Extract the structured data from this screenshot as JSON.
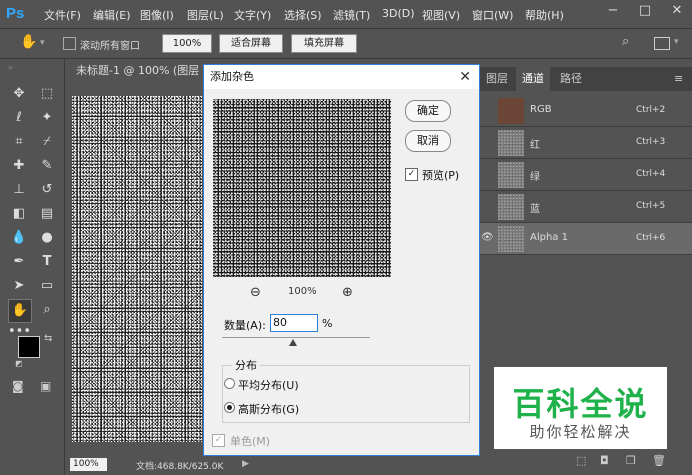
{
  "app": {
    "logo": "Ps"
  },
  "menu": [
    "文件(F)",
    "编辑(E)",
    "图像(I)",
    "图层(L)",
    "文字(Y)",
    "选择(S)",
    "滤镜(T)",
    "3D(D)",
    "视图(V)",
    "窗口(W)",
    "帮助(H)"
  ],
  "options": {
    "scroll_all_label": "滚动所有窗口",
    "zoom_value": "100%",
    "fit_screen": "适合屏幕",
    "fill_screen": "填充屏幕"
  },
  "document": {
    "tab_title": "未标题-1 @ 100% (图层 1",
    "status_zoom": "100%",
    "status_doc": "文档:468.8K/625.0K"
  },
  "dialog": {
    "title": "添加杂色",
    "ok": "确定",
    "cancel": "取消",
    "preview_label": "预览(P)",
    "preview_zoom": "100%",
    "amount_label": "数量(A):",
    "amount_value": "80",
    "amount_unit": "%",
    "amount_slider_fraction": 0.48,
    "distribution_label": "分布",
    "dist_uniform": "平均分布(U)",
    "dist_gaussian": "高斯分布(G)",
    "monochrome": "单色(M)"
  },
  "panel": {
    "tabs": [
      "图层",
      "通道",
      "路径"
    ],
    "channels": [
      {
        "name": "RGB",
        "shortcut": "Ctrl+2"
      },
      {
        "name": "红",
        "shortcut": "Ctrl+3"
      },
      {
        "name": "绿",
        "shortcut": "Ctrl+4"
      },
      {
        "name": "蓝",
        "shortcut": "Ctrl+5"
      },
      {
        "name": "Alpha 1",
        "shortcut": "Ctrl+6"
      }
    ]
  },
  "watermark": {
    "title": "百科全说",
    "subtitle": "助你轻松解决"
  },
  "colors": {
    "accent": "#2f7fd9",
    "watermark_green": "#1fb14a"
  }
}
